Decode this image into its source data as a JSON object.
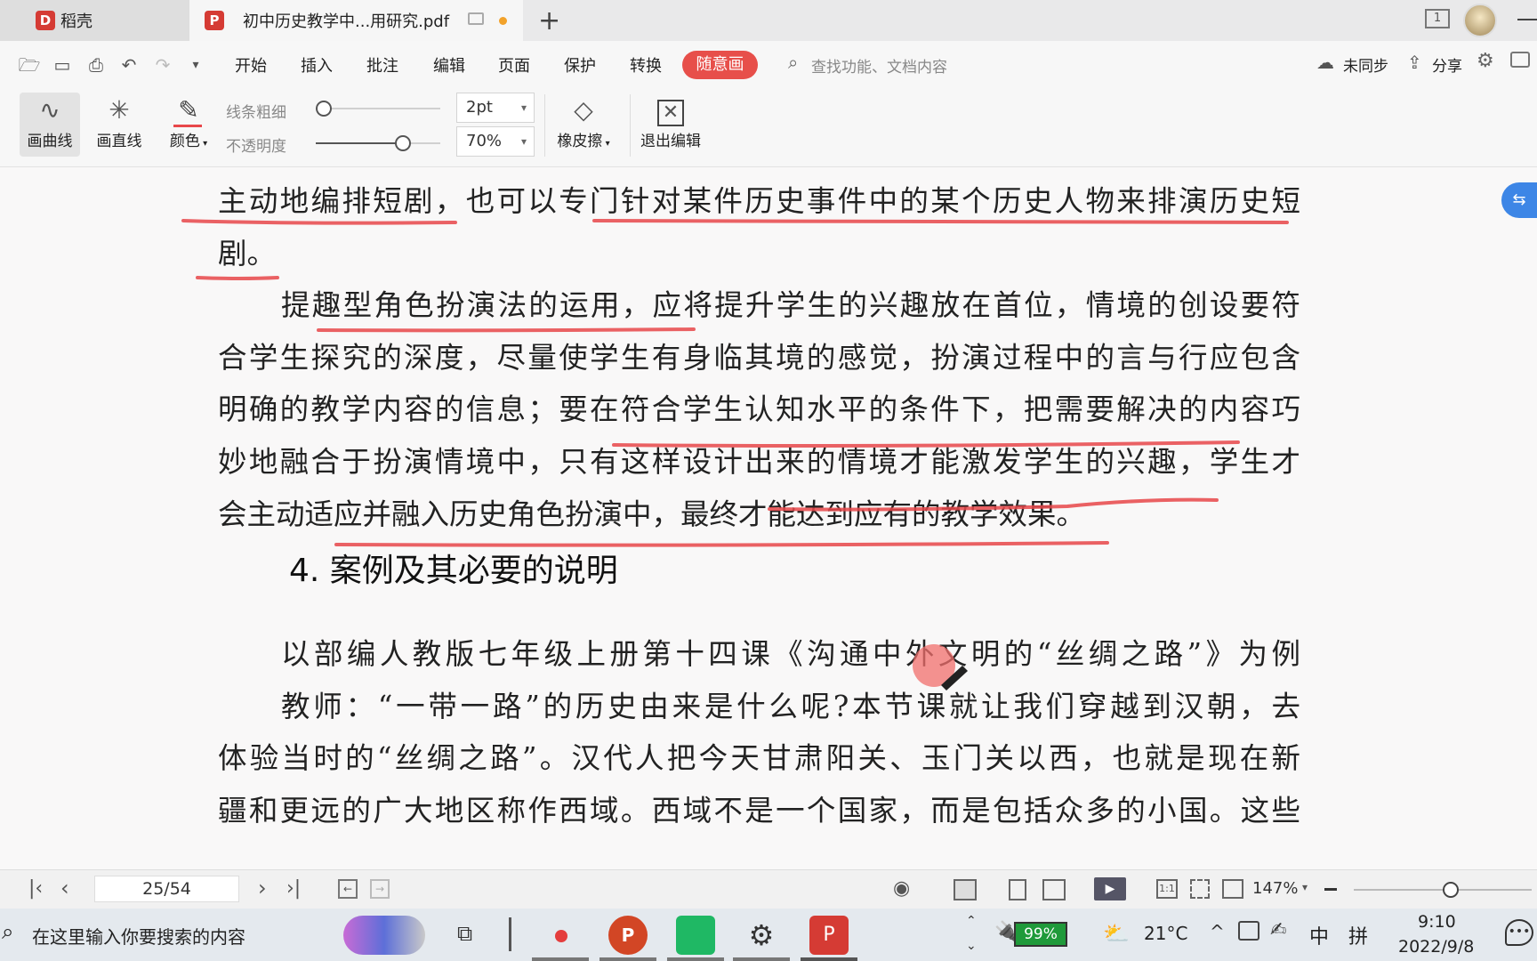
{
  "tabs": [
    {
      "label": "稻壳"
    },
    {
      "label": "初中历史教学中...用研究.pdf"
    }
  ],
  "menu": {
    "items": [
      "开始",
      "插入",
      "批注",
      "编辑",
      "页面",
      "保护",
      "转换"
    ],
    "active": "随意画",
    "search_placeholder": "查找功能、文档内容",
    "sync_label": "未同步",
    "share_label": "分享"
  },
  "ribbon": {
    "draw_curve": "画曲线",
    "draw_line": "画直线",
    "color": "颜色",
    "line_width_label": "线条粗细",
    "opacity_label": "不透明度",
    "line_width_value": "2pt",
    "opacity_value": "70%",
    "eraser": "橡皮擦",
    "exit_edit": "退出编辑",
    "opacity_fraction": 0.7
  },
  "document": {
    "lines": [
      "主动地编排短剧，也可以专门针对某件历史事件中的某个历史人物来排演历史短",
      "剧。",
      "提趣型角色扮演法的运用，应将提升学生的兴趣放在首位，情境的创设要符",
      "合学生探究的深度，尽量使学生有身临其境的感觉，扮演过程中的言与行应包含",
      "明确的教学内容的信息；要在符合学生认知水平的条件下，把需要解决的内容巧",
      "妙地融合于扮演情境中，只有这样设计出来的情境才能激发学生的兴趣，学生才",
      "会主动适应并融入历史角色扮演中，最终才能达到应有的教学效果。"
    ],
    "heading": "4. 案例及其必要的说明",
    "lines2": [
      "以部编人教版七年级上册第十四课《沟通中外文明的“丝绸之路”》为例",
      "教师：“一带一路”的历史由来是什么呢?本节课就让我们穿越到汉朝，去",
      "体验当时的“丝绸之路”。汉代人把今天甘肃阳关、玉门关以西，也就是现在新",
      "疆和更远的广大地区称作西域。西域不是一个国家，而是包括众多的小国。这些"
    ],
    "annotation_color": "#e8474a"
  },
  "statusbar": {
    "page_indicator": "25/54",
    "zoom": "147%"
  },
  "taskbar": {
    "search_placeholder": "在这里输入你要搜索的内容",
    "battery": "99%",
    "weather": "21°C",
    "ime_lang": "中",
    "ime_mode": "拼",
    "time": "9:10",
    "date": "2022/9/8"
  }
}
